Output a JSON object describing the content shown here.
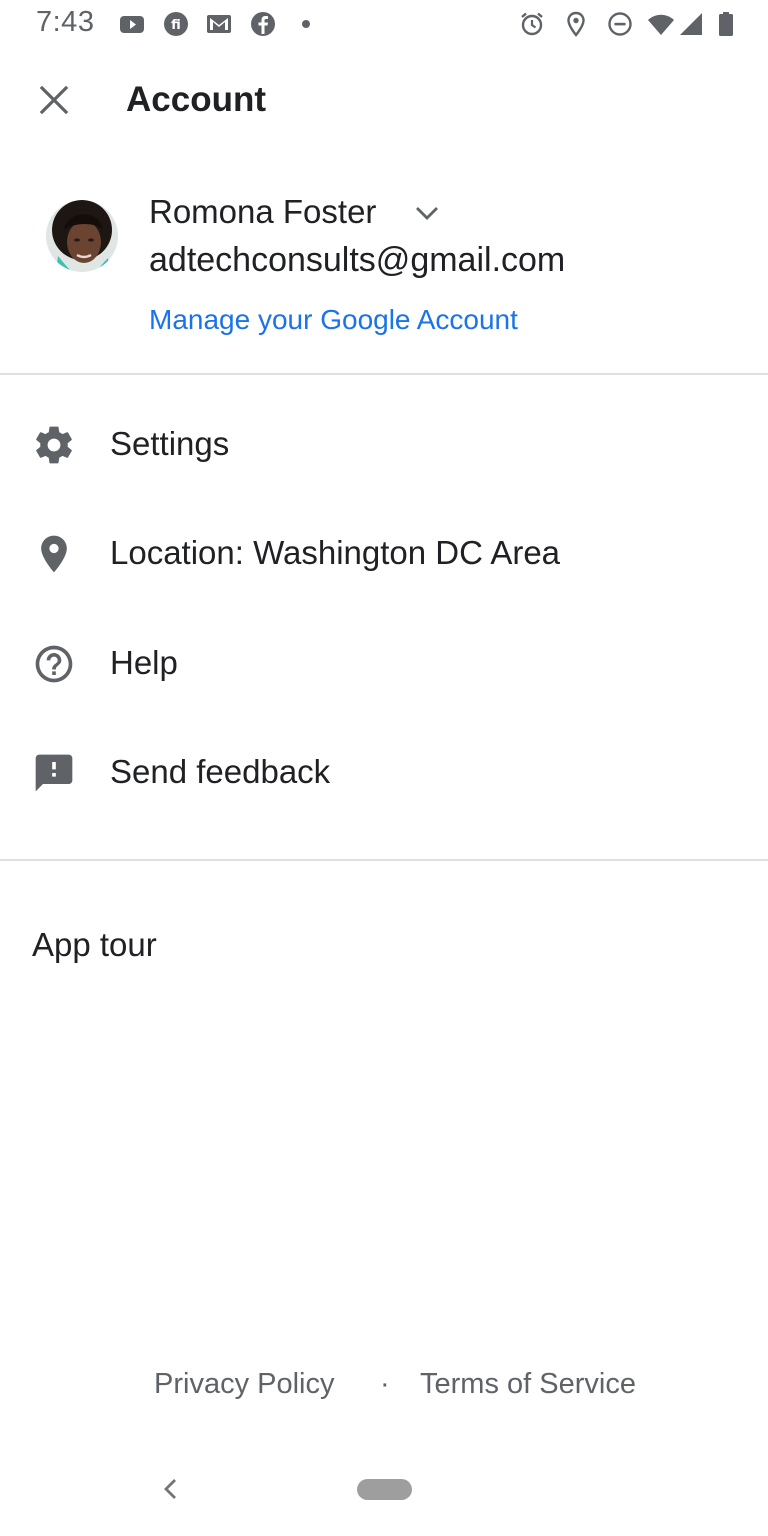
{
  "status_bar": {
    "time": "7:43",
    "left_icons": [
      "youtube-icon",
      "news-icon",
      "gmail-icon",
      "facebook-icon",
      "notification-dot-icon"
    ],
    "right_icons": [
      "alarm-icon",
      "location-pin-icon",
      "do-not-disturb-icon",
      "wifi-icon",
      "cell-signal-icon",
      "battery-icon"
    ]
  },
  "header": {
    "close_icon": "close-icon",
    "title": "Account"
  },
  "account": {
    "name": "Romona Foster",
    "email": "adtechconsults@gmail.com",
    "manage_label": "Manage your Google Account"
  },
  "menu": {
    "items": [
      {
        "label": "Settings",
        "icon": "gear-icon"
      },
      {
        "label": "Location: Washington DC Area",
        "icon": "location-pin-icon"
      },
      {
        "label": "Help",
        "icon": "help-circle-icon"
      },
      {
        "label": "Send feedback",
        "icon": "feedback-icon"
      }
    ]
  },
  "app_tour": "App tour",
  "footer": {
    "privacy": "Privacy Policy",
    "separator": "·",
    "terms": "Terms of Service"
  },
  "colors": {
    "link": "#1a73e8",
    "text": "#202124",
    "icon": "#5f6368",
    "divider": "#e0e0e0"
  }
}
